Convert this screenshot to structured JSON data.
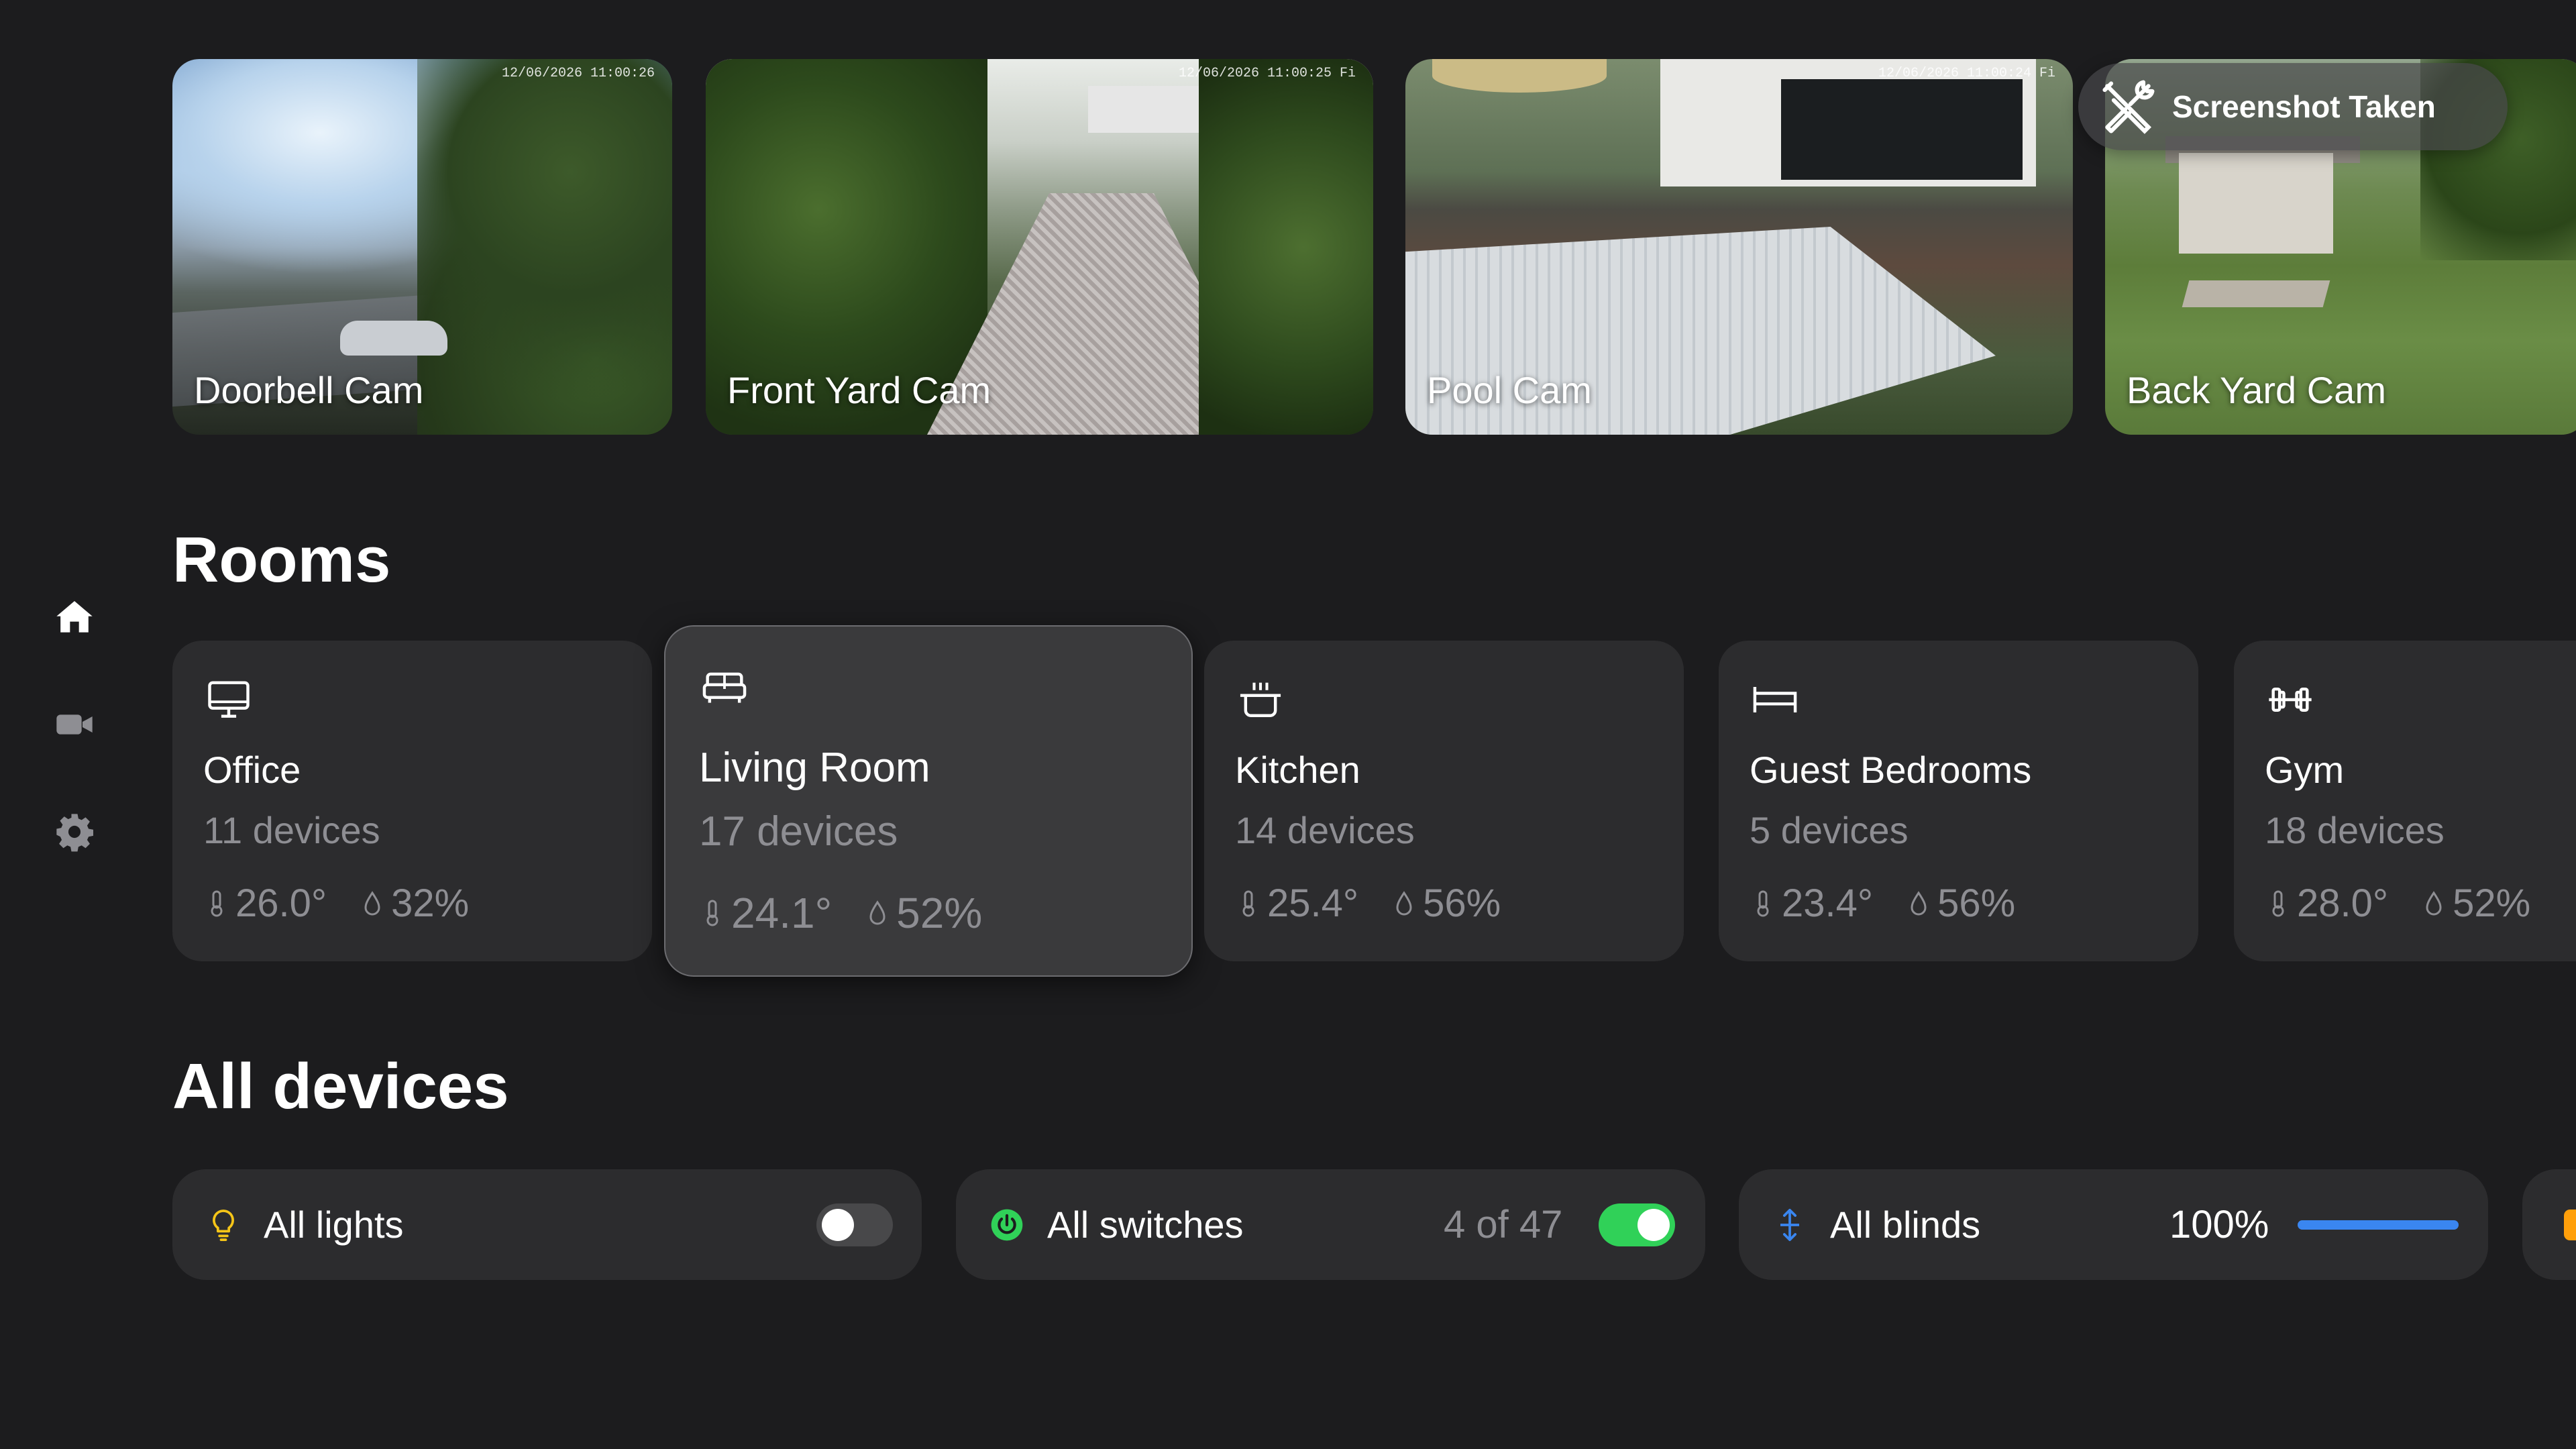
{
  "sidebar": {
    "items": [
      {
        "name": "home-icon",
        "active": true
      },
      {
        "name": "camera-icon",
        "active": false
      },
      {
        "name": "gear-icon",
        "active": false
      }
    ]
  },
  "cameras": [
    {
      "label": "Doorbell Cam",
      "timestamp": "12/06/2026 11:00:26"
    },
    {
      "label": "Front Yard Cam",
      "timestamp": "12/06/2026 11:00:25 Fi"
    },
    {
      "label": "Pool Cam",
      "timestamp": "12/06/2026 11:00:24 Fi"
    },
    {
      "label": "Back Yard Cam",
      "timestamp": ""
    }
  ],
  "toast": {
    "text": "Screenshot Taken",
    "icon": "tools-icon"
  },
  "rooms_title": "Rooms",
  "rooms": [
    {
      "name": "Office",
      "devices": "11 devices",
      "temp": "26.0°",
      "humidity": "32%",
      "icon": "monitor-icon"
    },
    {
      "name": "Living Room",
      "devices": "17 devices",
      "temp": "24.1°",
      "humidity": "52%",
      "icon": "sofa-icon",
      "selected": true
    },
    {
      "name": "Kitchen",
      "devices": "14 devices",
      "temp": "25.4°",
      "humidity": "56%",
      "icon": "pot-icon"
    },
    {
      "name": "Guest Bedrooms",
      "devices": "5 devices",
      "temp": "23.4°",
      "humidity": "56%",
      "icon": "bed-icon"
    },
    {
      "name": "Gym",
      "devices": "18 devices",
      "temp": "28.0°",
      "humidity": "52%",
      "icon": "dumbbell-icon"
    }
  ],
  "devices_title": "All devices",
  "devices": {
    "lights": {
      "label": "All lights",
      "on": false,
      "icon": "bulb-icon",
      "icon_color": "#f5c518"
    },
    "switches": {
      "label": "All switches",
      "count": "4 of 47",
      "on": true,
      "icon": "power-icon",
      "icon_color": "#30d158"
    },
    "blinds": {
      "label": "All blinds",
      "value": "100%",
      "level": 1.0,
      "icon": "blinds-icon",
      "icon_color": "#3a86f0"
    }
  },
  "colors": {
    "accent_green": "#30d158",
    "accent_blue": "#3a86f0",
    "accent_yellow": "#f5c518",
    "accent_orange": "#ff9f0a"
  }
}
